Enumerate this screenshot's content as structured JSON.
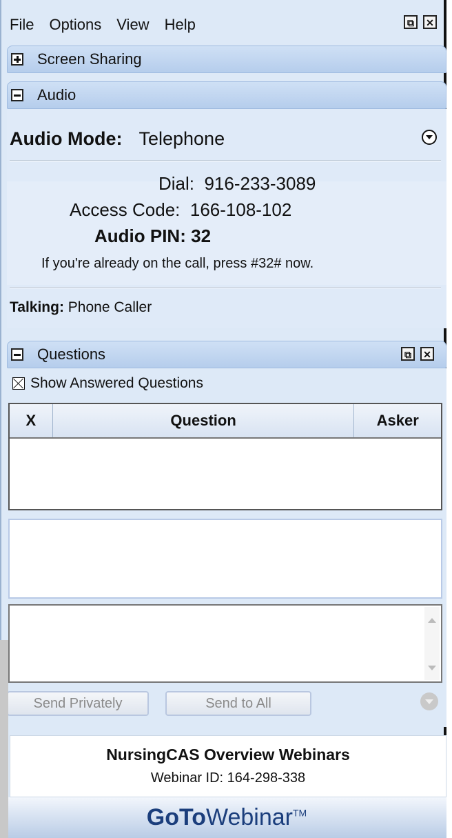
{
  "menu": {
    "items": [
      "File",
      "Options",
      "View",
      "Help"
    ]
  },
  "window_buttons": {
    "popout": "⧉",
    "close": "✕"
  },
  "screen_sharing": {
    "title": "Screen Sharing"
  },
  "audio": {
    "title": "Audio",
    "mode_label": "Audio Mode:",
    "mode_value": "Telephone",
    "dial_label": "Dial:",
    "dial_value": "916-233-3089",
    "access_label": "Access Code:",
    "access_value": "166-108-102",
    "pin_label": "Audio PIN:",
    "pin_value": "32",
    "hint": "If you're already on the call, press #32# now.",
    "talking_label": "Talking:",
    "talking_value": "Phone Caller"
  },
  "questions": {
    "title": "Questions",
    "show_answered": "Show Answered Questions",
    "columns": [
      "X",
      "Question",
      "Asker"
    ],
    "send_private": "Send Privately",
    "send_all": "Send to All"
  },
  "webinar": {
    "title": "NursingCAS Overview Webinars",
    "id_text": "Webinar ID: 164-298-338"
  },
  "brand": {
    "bold": "GoTo",
    "light": "Webinar",
    "tm": "TM"
  }
}
